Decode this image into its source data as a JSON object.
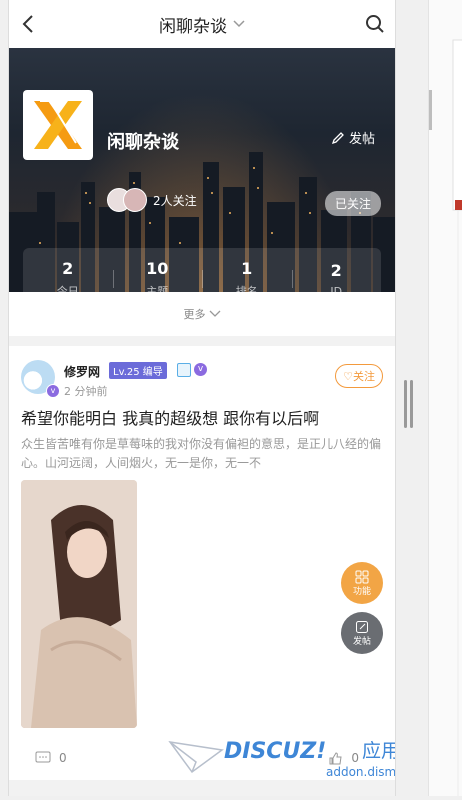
{
  "header": {
    "title": "闲聊杂谈"
  },
  "forum": {
    "name": "闲聊杂谈",
    "post_label": "发帖",
    "follow_count_text": "2人关注",
    "followed_label": "已关注",
    "stats": [
      {
        "value": "2",
        "label": "今日"
      },
      {
        "value": "10",
        "label": "主题"
      },
      {
        "value": "1",
        "label": "排名"
      },
      {
        "value": "2",
        "label": "ID"
      }
    ],
    "more_label": "更多"
  },
  "post": {
    "author": "修罗网",
    "level": "Lv.25 编导",
    "time": "2 分钟前",
    "follow_label": "关注",
    "title": "希望你能明白 我真的超级想 跟你有以后啊",
    "excerpt": "众生皆苦唯有你是草莓味的我对你没有偏袒的意思，是正儿八经的偏心。山河远阔，人间烟火，无一是你，无一不",
    "comments": "0",
    "likes": "0"
  },
  "floating": {
    "function_label": "功能",
    "post_label": "发帖"
  },
  "watermark": {
    "brand": "DISCUZ!",
    "cn": "应用中心",
    "url": "addon.dismall.com"
  },
  "colors": {
    "accent": "#f39a3d",
    "level_badge": "#6b6bd9",
    "verify": "#8b6be0"
  }
}
